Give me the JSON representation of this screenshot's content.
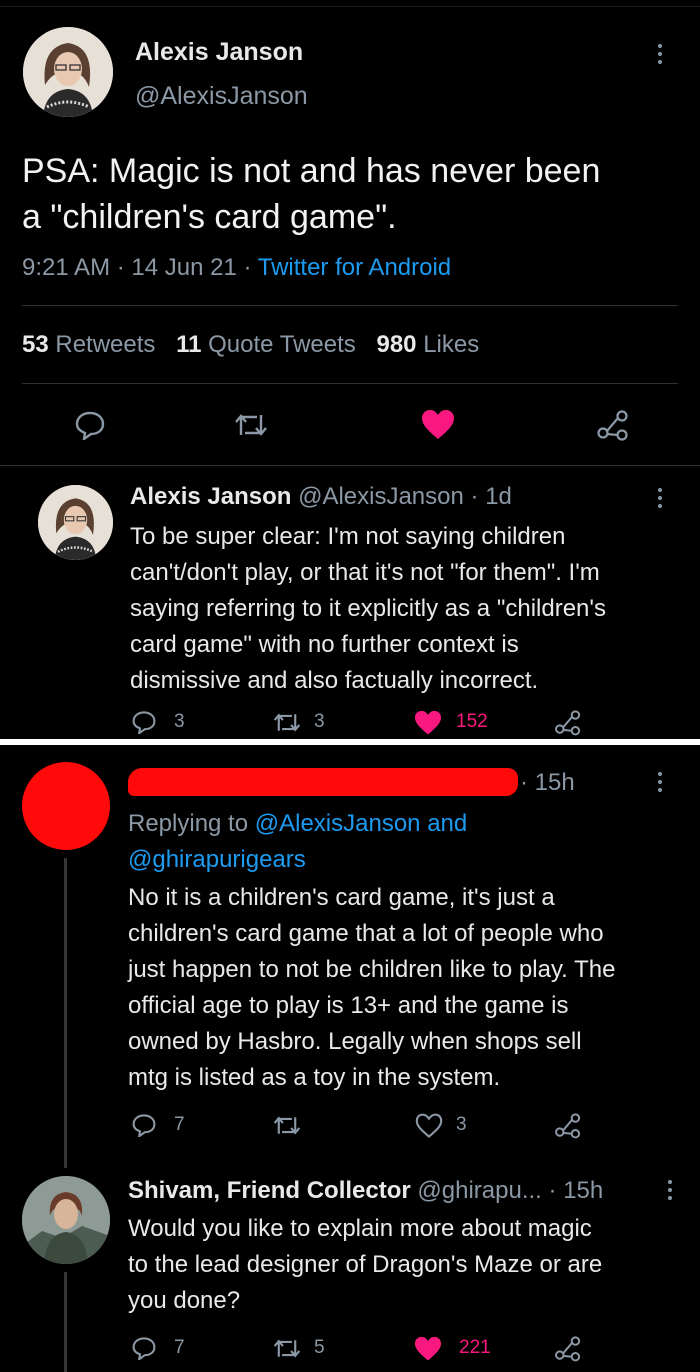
{
  "main_tweet": {
    "name": "Alexis Janson",
    "handle": "@AlexisJanson",
    "text_line1": "PSA: Magic is not and has never been",
    "text_line2": "a \"children's card game\".",
    "time": "9:21 AM",
    "date": "14 Jun 21",
    "source": "Twitter for Android",
    "retweets_count": "53",
    "retweets_label": "Retweets",
    "quotes_count": "11",
    "quotes_label": "Quote Tweets",
    "likes_count": "980",
    "likes_label": "Likes"
  },
  "reply_1": {
    "name": "Alexis Janson",
    "handle": "@AlexisJanson",
    "age": "1d",
    "lines": [
      "To be super clear: I'm not saying children",
      "can't/don't play, or that it's not \"for them\". I'm",
      "saying referring to it explicitly as a \"children's",
      "card game\" with no further context is",
      "dismissive and also factually incorrect."
    ],
    "replies": "3",
    "retweets": "3",
    "likes": "152"
  },
  "reply_2": {
    "age": "15h",
    "replying_prefix": "Replying to",
    "replying_handle1": "@AlexisJanson",
    "replying_and": "and",
    "replying_handle2": "@ghirapurigears",
    "lines": [
      "No it is a children's card game, it's just a",
      "children's card game that a lot of people who",
      "just happen to not be children like to play. The",
      "official age to play is 13+ and the game is",
      "owned by Hasbro. Legally when shops sell",
      "mtg is listed as a toy in the system."
    ],
    "replies": "7",
    "likes": "3"
  },
  "reply_3": {
    "name": "Shivam, Friend Collector",
    "handle": "@ghirapu...",
    "age": "15h",
    "lines": [
      "Would you like to explain more about magic",
      "to the lead designer of Dragon's Maze or are",
      "you done?"
    ],
    "replies": "7",
    "retweets": "5",
    "likes": "221"
  },
  "colors": {
    "background": "#000000",
    "accent_blue": "#1d9bf0",
    "like_red": "#f91880",
    "redaction_red": "#ff0a0a",
    "muted": "#8b98a5"
  }
}
